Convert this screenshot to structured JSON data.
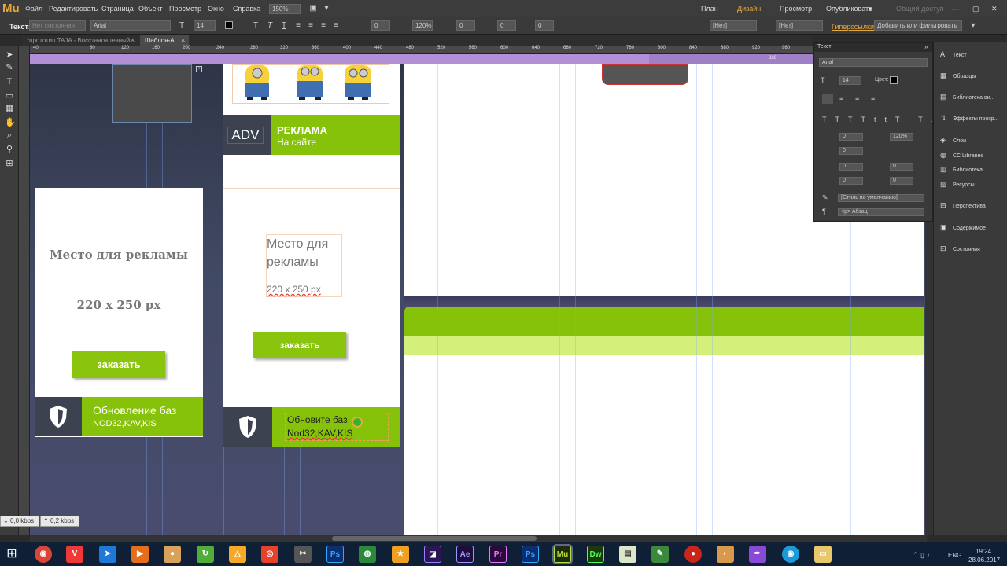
{
  "app": {
    "logo": "Mu"
  },
  "menu": [
    "Файл",
    "Редактировать",
    "Страница",
    "Объект",
    "Просмотр",
    "Окно",
    "Справка"
  ],
  "zoom": "150%",
  "modes": {
    "plan": "План",
    "design": "Дизайн",
    "preview": "Просмотр",
    "publish": "Опубликовать",
    "shared": "Общий доступ"
  },
  "control": {
    "text_label": "Текст:",
    "state": "Нет состояния",
    "font": "Arial",
    "size": "14",
    "leading": "120%",
    "val0a": "0",
    "val0b": "0",
    "val0c": "0",
    "val0d": "0",
    "none1": "[Нет]",
    "none2": "[Нет]",
    "hyperlinks": "Гиперссылки:",
    "filter_placeholder": "Добавить или фильтровать"
  },
  "tabs": [
    "*прототип TAJA - Восстановленный",
    "Шаблон-А"
  ],
  "ruler_h": [
    "40",
    "80",
    "120",
    "160",
    "200",
    "240",
    "280",
    "320",
    "360",
    "400",
    "440",
    "480",
    "520",
    "560",
    "600",
    "640",
    "680",
    "720",
    "760",
    "800",
    "840",
    "880",
    "920",
    "960"
  ],
  "ruler_h2": "328",
  "text_panel": {
    "title": "Текст",
    "font": "Arial",
    "size": "14",
    "color_label": "Цвет:",
    "tracking": "0",
    "leading": "120%",
    "indent": "0",
    "space_before": "0",
    "space_after": "0",
    "left_indent": "0",
    "right_indent": "0",
    "style_default": "[Стиль по умолчанию]",
    "paragraph": "<p> Абзац"
  },
  "dock": [
    "Текст",
    "Образцы",
    "Библиотека ви...",
    "Эффекты прокр...",
    "Слои",
    "CC Libraries",
    "Библиотека",
    "Ресурсы",
    "Перспектива",
    "Содержимое",
    "Состояния"
  ],
  "ad1": {
    "title": "Место для рекламы",
    "size": "220 x 250 px",
    "button": "заказать",
    "banner_title": "Обновление баз",
    "banner_sub": "NOD32,KAV,KIS"
  },
  "adv_block": {
    "tag": "ADV",
    "title": "РЕКЛАМА",
    "sub": "На сайте"
  },
  "ad2": {
    "title": "Место для рекламы",
    "size": "220 x 250 px",
    "button": "заказать",
    "banner_line1": "Обновите баз",
    "banner_line2": "Nod32,KAV,KIS"
  },
  "net": {
    "down": "0,0 kbps",
    "up": "0,2 kbps"
  },
  "tray": {
    "lang": "ENG",
    "time": "19:24",
    "date": "28.06.2017"
  },
  "taskbar_apps": [
    "Chrome",
    "Vivaldi",
    "Arrow",
    "Media",
    "Pizza",
    "Sync",
    "Avast",
    "Camera",
    "Tool",
    "Ps",
    "Globe",
    "Star",
    "Ae-purple",
    "Ae",
    "Pr",
    "Ps",
    "Mu",
    "Dw",
    "Files",
    "Brush",
    "Record",
    "Paint",
    "Pen",
    "Chrome2",
    "Folder"
  ],
  "colors": {
    "accent_orange": "#e8a93b",
    "green": "#87c20a",
    "lime": "#d4f07a",
    "purple": "#b38fd6"
  }
}
